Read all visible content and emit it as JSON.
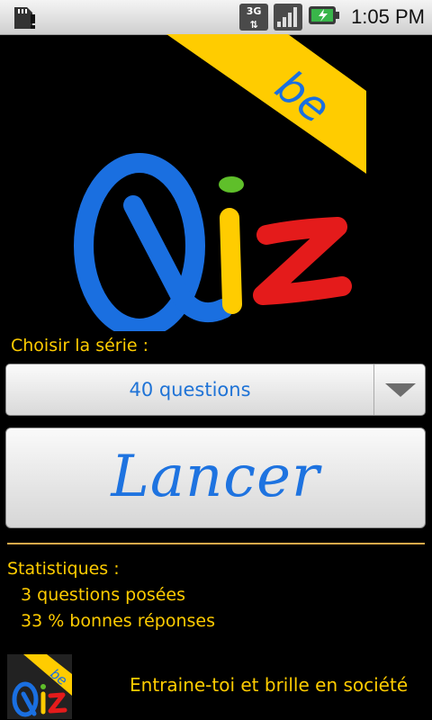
{
  "status_bar": {
    "time": "1:05 PM",
    "network_type": "3G",
    "icons": [
      "sd-card-warning-icon",
      "network-3g-icon",
      "signal-icon",
      "battery-charging-icon"
    ]
  },
  "logo": {
    "banner_text": "be",
    "letters": [
      "Q",
      "i",
      "z"
    ],
    "colors": {
      "q": "#1a6fe0",
      "i": "#ffcc00",
      "dot": "#5fbf2a",
      "z": "#e41b1b",
      "banner": "#ffcc00"
    }
  },
  "series": {
    "label": "Choisir la série :",
    "selected": "40 questions"
  },
  "launch_button": {
    "label": "Lancer"
  },
  "stats": {
    "title": "Statistiques :",
    "questions_asked": "3 questions posées",
    "good_answers": "33 % bonnes réponses"
  },
  "footer": {
    "tagline": "Entraine-toi et brille en société"
  },
  "colors": {
    "accent": "#ffcc00",
    "separator": "#e2a94a",
    "button_text": "#1e73e0",
    "background": "#000000"
  }
}
